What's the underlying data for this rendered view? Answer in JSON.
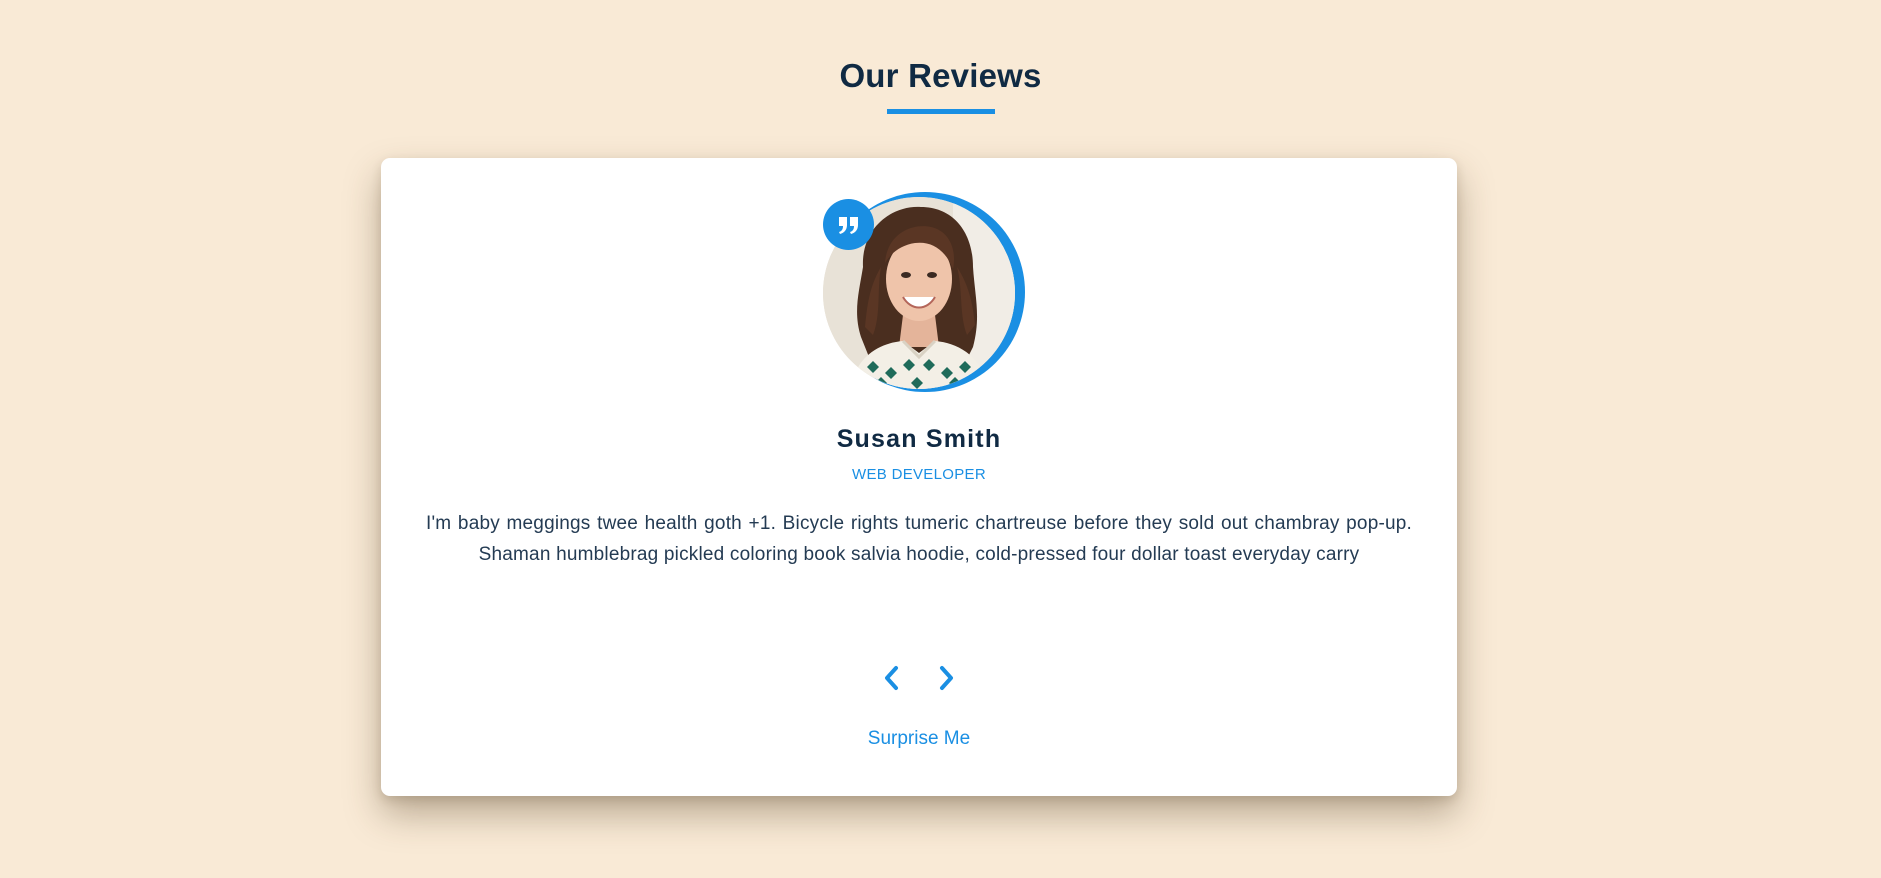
{
  "header": {
    "title": "Our Reviews"
  },
  "review": {
    "name": "Susan Smith",
    "job": "WEB DEVELOPER",
    "text": "I'm baby meggings twee health goth +1. Bicycle rights tumeric chartreuse before they sold out chambray pop-up. Shaman humblebrag pickled coloring book salvia hoodie, cold-pressed four dollar toast everyday carry"
  },
  "controls": {
    "prev_icon": "chevron-left-icon",
    "next_icon": "chevron-right-icon",
    "random_label": "Surprise Me"
  },
  "colors": {
    "background": "#f9ead6",
    "accent": "#1a8fe3",
    "heading": "#102a43",
    "body_text": "#243b53",
    "card": "#ffffff"
  }
}
